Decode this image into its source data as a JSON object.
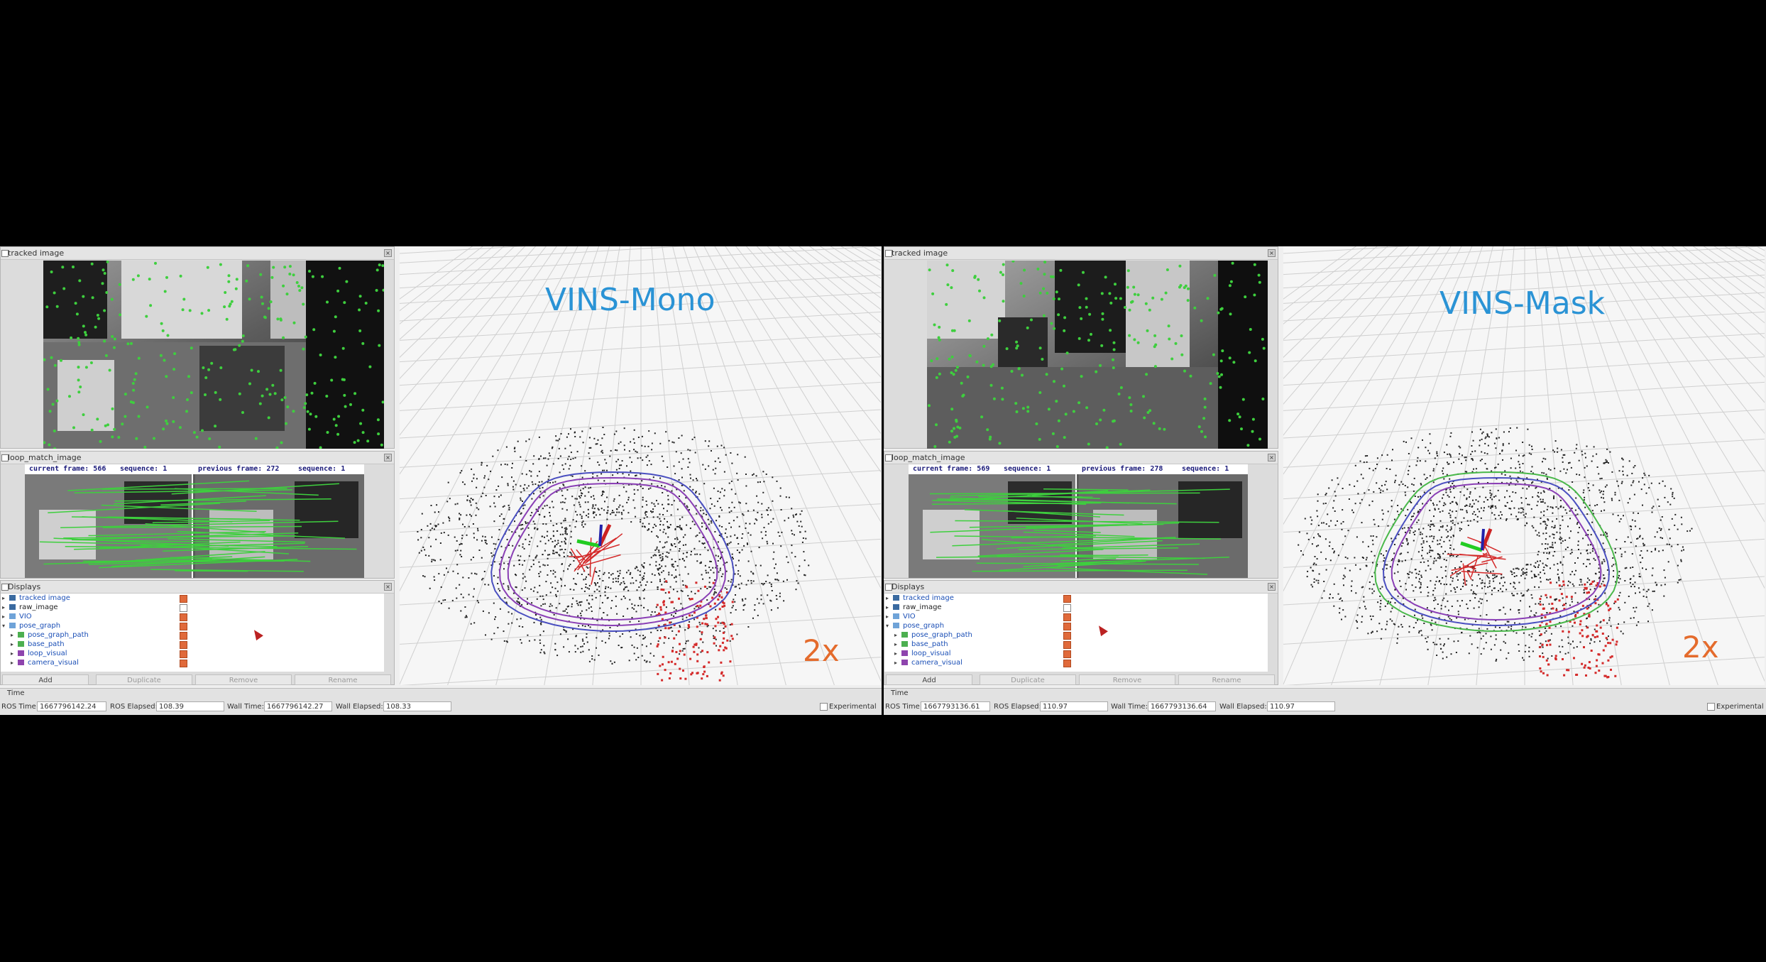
{
  "halves": [
    {
      "panels": {
        "tracked_title": "tracked image",
        "loop_title": "loop_match_image",
        "displays_title": "Displays"
      },
      "loop_header": {
        "current_label": "current frame: 566",
        "current_seq": "sequence: 1",
        "previous_label": "previous frame: 272",
        "previous_seq": "sequence: 1"
      },
      "display_items": [
        {
          "label": "tracked image",
          "checked": true
        },
        {
          "label": "raw_image",
          "checked": false
        },
        {
          "label": "VIO",
          "checked": true
        },
        {
          "label": "pose_graph",
          "checked": true
        },
        {
          "label": "pose_graph_path",
          "checked": true
        },
        {
          "label": "base_path",
          "checked": true
        },
        {
          "label": "loop_visual",
          "checked": true
        },
        {
          "label": "camera_visual",
          "checked": true
        }
      ],
      "buttons": {
        "add": "Add",
        "duplicate": "Duplicate",
        "remove": "Remove",
        "rename": "Rename"
      },
      "scene_title": "VINS-Mono",
      "speed": "2x",
      "time": {
        "section": "Time",
        "ros_time_label": "ROS Time:",
        "ros_time": "1667796142.24",
        "ros_elapsed_label": "ROS Elapsed:",
        "ros_elapsed": "108.39",
        "wall_time_label": "Wall Time:",
        "wall_time": "1667796142.27",
        "wall_elapsed_label": "Wall Elapsed:",
        "wall_elapsed": "108.33",
        "experimental": "Experimental"
      }
    },
    {
      "panels": {
        "tracked_title": "tracked image",
        "loop_title": "loop_match_image",
        "displays_title": "Displays"
      },
      "loop_header": {
        "current_label": "current frame: 569",
        "current_seq": "sequence: 1",
        "previous_label": "previous frame: 278",
        "previous_seq": "sequence: 1"
      },
      "display_items": [
        {
          "label": "tracked image",
          "checked": true
        },
        {
          "label": "raw_image",
          "checked": false
        },
        {
          "label": "VIO",
          "checked": true
        },
        {
          "label": "pose_graph",
          "checked": true
        },
        {
          "label": "pose_graph_path",
          "checked": true
        },
        {
          "label": "base_path",
          "checked": true
        },
        {
          "label": "loop_visual",
          "checked": true
        },
        {
          "label": "camera_visual",
          "checked": true
        }
      ],
      "buttons": {
        "add": "Add",
        "duplicate": "Duplicate",
        "remove": "Remove",
        "rename": "Rename"
      },
      "scene_title": "VINS-Mask",
      "speed": "2x",
      "time": {
        "section": "Time",
        "ros_time_label": "ROS Time:",
        "ros_time": "1667793136.61",
        "ros_elapsed_label": "ROS Elapsed:",
        "ros_elapsed": "110.97",
        "wall_time_label": "Wall Time:",
        "wall_time": "1667793136.64",
        "wall_elapsed_label": "Wall Elapsed:",
        "wall_elapsed": "110.97",
        "experimental": "Experimental"
      }
    }
  ],
  "colors": {
    "title_blue": "#2a93d5",
    "speed_orange": "#e46b2c",
    "feature_green": "#3ecf3e",
    "path_purple": "#8a3fb5",
    "path_blue": "#4a4fc0",
    "path_green": "#49b84a",
    "loop_red": "#d42a2a"
  }
}
